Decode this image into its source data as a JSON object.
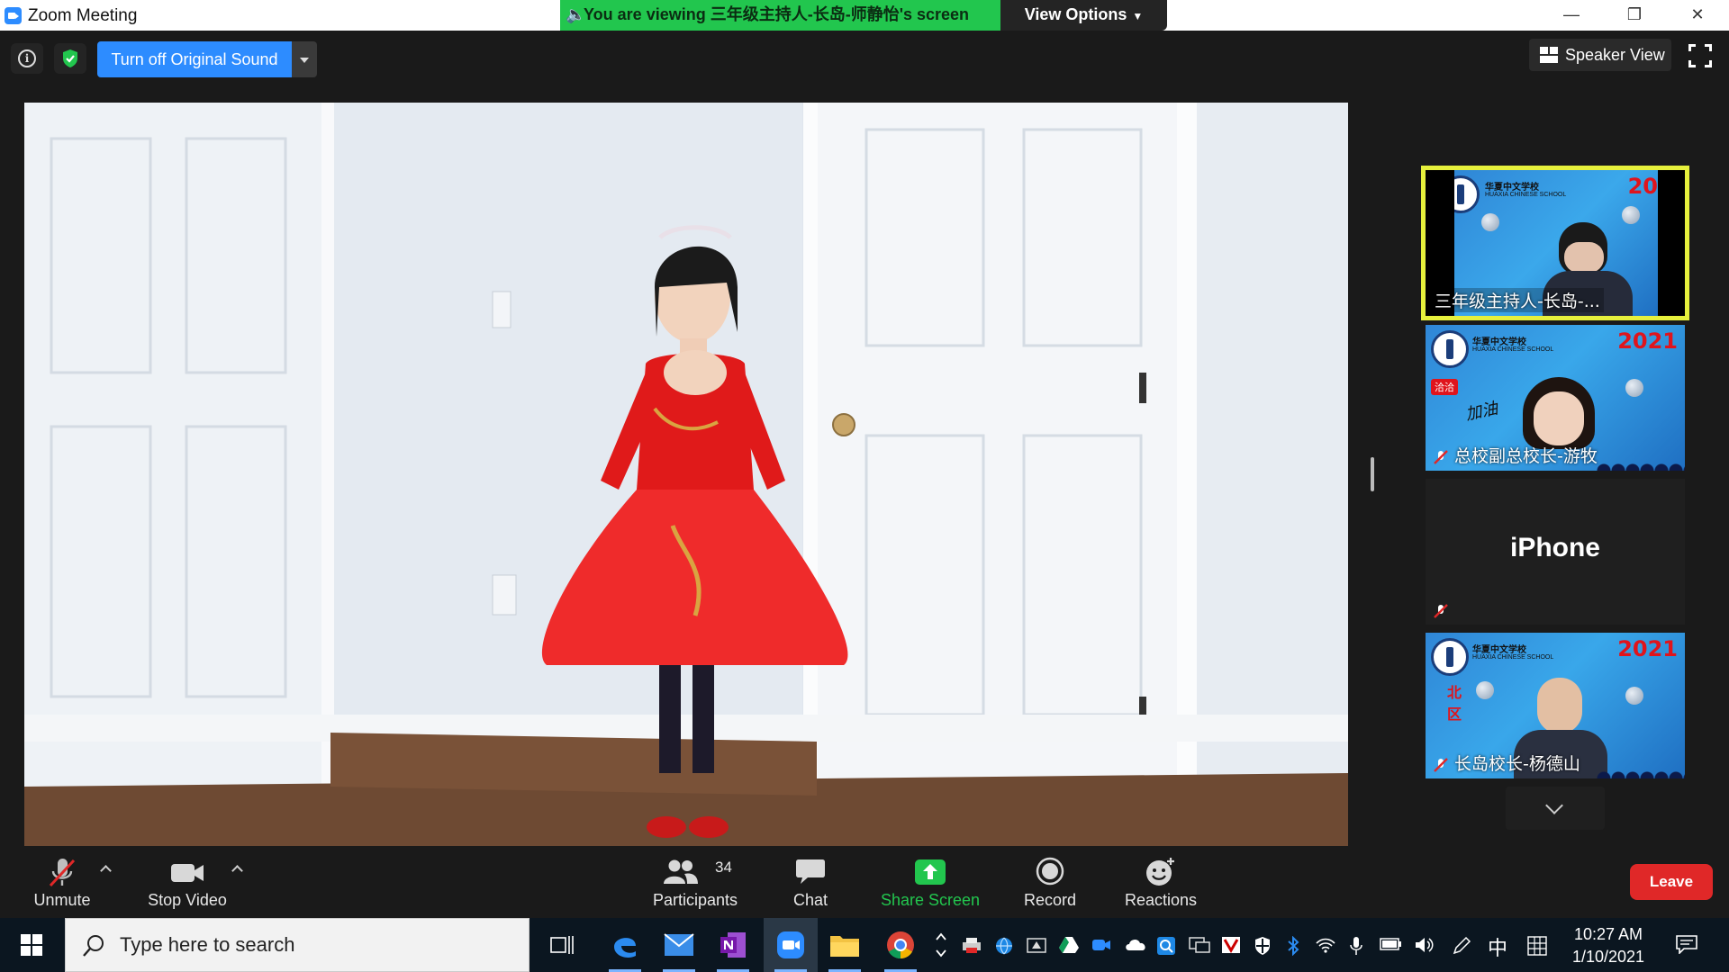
{
  "window": {
    "title": "Zoom Meeting",
    "minimize_glyph": "—",
    "restore_glyph": "❐",
    "close_glyph": "✕"
  },
  "share_banner": {
    "text": "You are viewing 三年级主持人-长岛-师静怡's screen",
    "view_options_label": "View Options"
  },
  "top_controls": {
    "original_sound_label": "Turn off Original Sound",
    "speaker_view_label": "Speaker View"
  },
  "gallery": {
    "tiles": [
      {
        "name": "三年级主持人-长岛-...",
        "active": true,
        "muted": false,
        "school": "华夏中文学校",
        "school_en": "HUAXIA CHINESE SCHOOL",
        "year": "20"
      },
      {
        "name": "总校副总校长-游牧",
        "active": false,
        "muted": true,
        "school": "华夏中文学校",
        "school_en": "HUAXIA CHINESE SCHOOL",
        "year": "2021",
        "sticker": "加油",
        "badge": "洽洽"
      },
      {
        "name": "iPhone",
        "active": false,
        "muted": true
      },
      {
        "name": "长岛校长-杨德山",
        "active": false,
        "muted": true,
        "school": "华夏中文学校",
        "school_en": "HUAXIA CHINESE SCHOOL",
        "year": "2021",
        "region": "北区"
      }
    ]
  },
  "toolbar": {
    "unmute": "Unmute",
    "stop_video": "Stop Video",
    "participants": "Participants",
    "participants_count": "34",
    "chat": "Chat",
    "share_screen": "Share Screen",
    "record": "Record",
    "reactions": "Reactions",
    "leave": "Leave"
  },
  "taskbar": {
    "search_placeholder": "Type here to search",
    "ime_label": "中",
    "time": "10:27 AM",
    "date": "1/10/2021"
  },
  "colors": {
    "accent": "#2d8cff",
    "banner": "#22c64e",
    "leave": "#e02828",
    "active_speaker": "#e6f03c"
  }
}
